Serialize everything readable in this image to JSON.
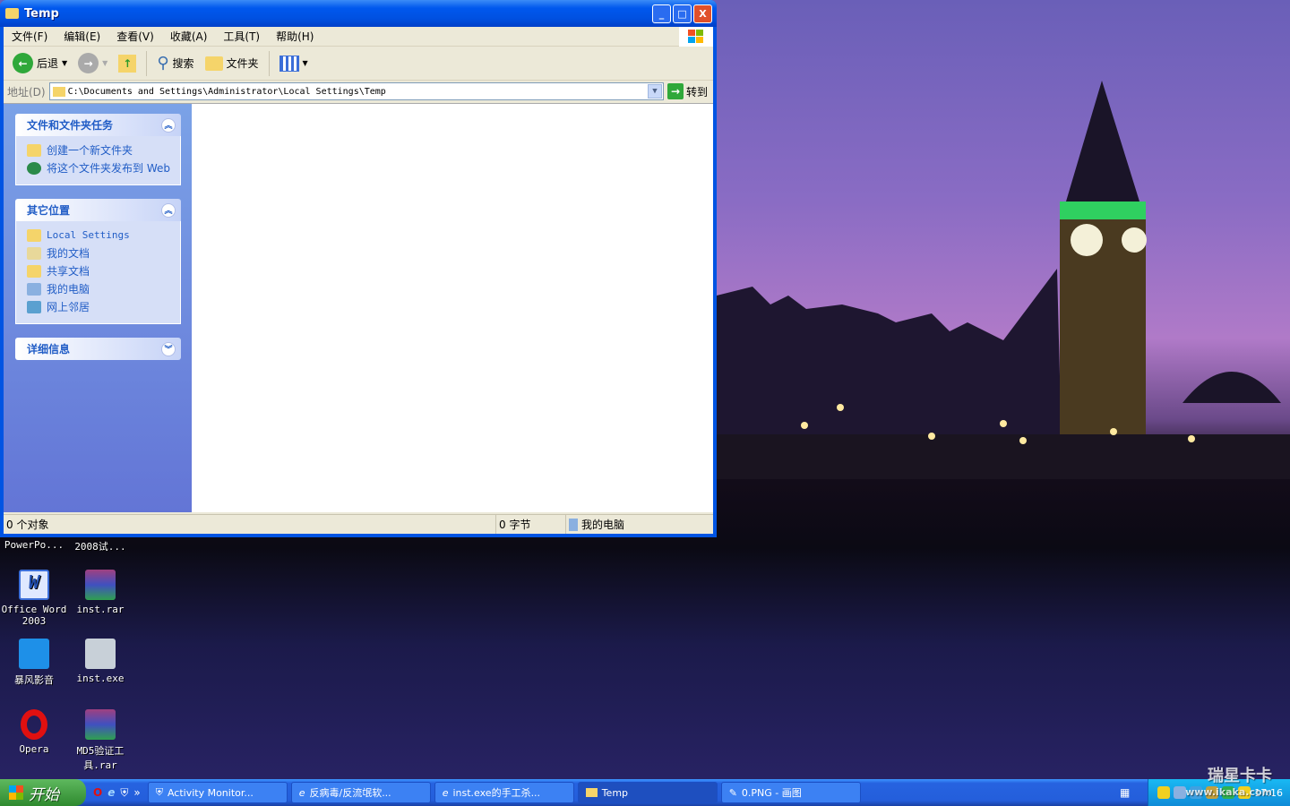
{
  "window": {
    "title": "Temp",
    "buttons": {
      "minimize": "_",
      "maximize": "□",
      "close": "X"
    }
  },
  "menu": [
    "文件(F)",
    "编辑(E)",
    "查看(V)",
    "收藏(A)",
    "工具(T)",
    "帮助(H)"
  ],
  "toolbar": {
    "back": "后退",
    "search": "搜索",
    "folders": "文件夹"
  },
  "address": {
    "label": "地址(D)",
    "value": "C:\\Documents and Settings\\Administrator\\Local Settings\\Temp",
    "go": "转到"
  },
  "tasks": {
    "title": "文件和文件夹任务",
    "items": [
      "创建一个新文件夹",
      "将这个文件夹发布到 Web"
    ]
  },
  "places": {
    "title": "其它位置",
    "items": [
      "Local Settings",
      "我的文档",
      "共享文档",
      "我的电脑",
      "网上邻居"
    ]
  },
  "details": {
    "title": "详细信息"
  },
  "status": {
    "objects": "0 个对象",
    "size": "0 字节",
    "location": "我的电脑"
  },
  "desktop_icons": [
    "PowerPo...",
    "2008试...",
    "Office Word 2003",
    "inst.rar",
    "暴风影音",
    "inst.exe",
    "Opera",
    "MD5验证工具.rar"
  ],
  "taskbar": {
    "start": "开始",
    "more": "»",
    "tasks": [
      "Activity Monitor...",
      "反病毒/反流氓软...",
      "inst.exe的手工杀...",
      "Temp",
      "0.PNG - 画图"
    ],
    "clock": "17:16"
  },
  "watermark": {
    "line1": "瑞星卡卡",
    "line2": "www.ikaka.com"
  }
}
